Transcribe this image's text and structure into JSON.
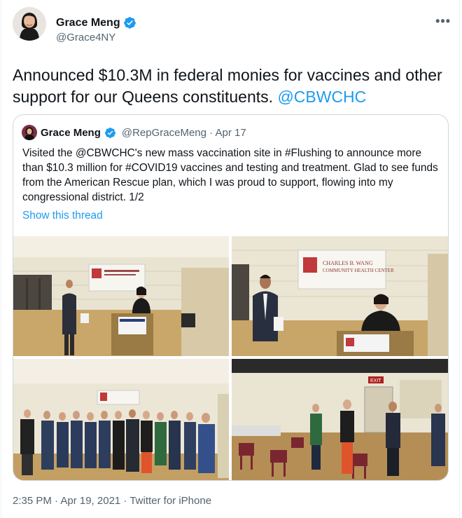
{
  "tweet": {
    "author_name": "Grace Meng",
    "author_handle": "@Grace4NY",
    "text_main": "Announced $10.3M in federal monies for vaccines and other support for our Queens constituents. ",
    "text_mention": "@CBWCHC",
    "more_label": "•••",
    "footer": "2:35 PM · Apr 19, 2021 · Twitter for iPhone"
  },
  "quote": {
    "author_name": "Grace Meng",
    "meta": "@RepGraceMeng · Apr 17",
    "text": "Visited the @CBWCHC's new mass vaccination site in #Flushing to announce more than $10.3 million for #COVID19 vaccines and testing and treatment. Glad to see funds from the American Rescue plan, which I was proud to support, flowing into my congressional district. 1/2",
    "show_thread": "Show this thread"
  },
  "photos": {
    "banner_text": "CHARLES B. WANG\nCOMMUNITY HEALTH CENTER",
    "exit_sign": "EXIT"
  },
  "colors": {
    "link": "#1d9bf0",
    "verified": "#1d9bf0",
    "text_secondary": "#536471"
  },
  "icons": {
    "verified": "verified-badge-icon",
    "more": "more-icon"
  }
}
